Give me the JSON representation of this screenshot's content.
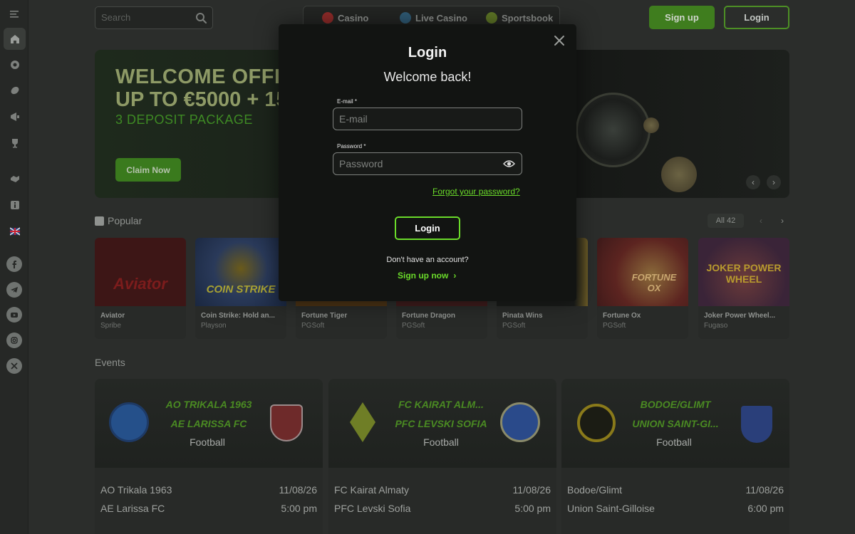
{
  "header": {
    "search_placeholder": "Search",
    "nav": [
      {
        "label": "Casino",
        "icon": "cherry-icon",
        "color": "#b3322f"
      },
      {
        "label": "Live Casino",
        "icon": "globe-icon",
        "color": "#3b6d8c"
      },
      {
        "label": "Sportsbook",
        "icon": "tennis-ball-icon",
        "color": "#6f8a2c"
      }
    ],
    "signup_label": "Sign up",
    "login_label": "Login"
  },
  "sidebar": {
    "items": [
      "menu-icon",
      "home-icon",
      "casino-chip-icon",
      "sports-ball-icon",
      "promotions-icon",
      "trophy-icon",
      "handshake-icon",
      "info-icon",
      "uk-flag-icon"
    ],
    "social": [
      "facebook-icon",
      "telegram-icon",
      "youtube-icon",
      "instagram-icon",
      "x-icon"
    ]
  },
  "hero": {
    "line1": "WELCOME OFFE",
    "line2": "UP TO €5000 + 15",
    "line3": "3 DEPOSIT PACKAGE",
    "cta": "Claim Now",
    "prev": "‹",
    "next": "›"
  },
  "popular": {
    "title": "Popular",
    "all_label": "All",
    "all_count": "42",
    "prev": "‹",
    "next": "›",
    "games": [
      {
        "name": "Aviator",
        "provider": "Spribe",
        "thumb_text": "Aviator",
        "bg": "#4a1818"
      },
      {
        "name": "Coin Strike: Hold an...",
        "provider": "Playson",
        "thumb_text": "COIN STRIKE",
        "bg": "#1c2f52"
      },
      {
        "name": "Fortune Tiger",
        "provider": "PGSoft",
        "thumb_text": "",
        "bg": "#5a3a16"
      },
      {
        "name": "Fortune Dragon",
        "provider": "PGSoft",
        "thumb_text": "",
        "bg": "#4a2020"
      },
      {
        "name": "Pinata Wins",
        "provider": "PGSoft",
        "thumb_text": "",
        "bg": "#5a4a1a"
      },
      {
        "name": "Fortune Ox",
        "provider": "PGSoft",
        "thumb_text": "FORTUNE OX",
        "bg": "#6a2420"
      },
      {
        "name": "Joker Power Wheel...",
        "provider": "Fugaso",
        "thumb_text": "JOKER POWER WHEEL",
        "bg": "#3a2438"
      }
    ]
  },
  "events": {
    "title": "Events",
    "items": [
      {
        "team1_banner": "AO TRIKALA 1963",
        "team2_banner": "AE LARISSA FC",
        "sport": "Football",
        "team1": "AO Trikala 1963",
        "team2": "AE Larissa FC",
        "date": "11/08/26",
        "time": "5:00 pm",
        "logo1_color": "#25508a",
        "logo2_color": "#6e2a2a"
      },
      {
        "team1_banner": "FC KAIRAT ALM...",
        "team2_banner": "PFC LEVSKI SOFIA",
        "sport": "Football",
        "team1": "FC Kairat Almaty",
        "team2": "PFC Levski Sofia",
        "date": "11/08/26",
        "time": "5:00 pm",
        "logo1_color": "#7a8a2a",
        "logo2_color": "#2a4a8a"
      },
      {
        "team1_banner": "BODOE/GLIMT",
        "team2_banner": "UNION SAINT-GI...",
        "sport": "Football",
        "team1": "Bodoe/Glimt",
        "team2": "Union Saint-Gilloise",
        "date": "11/08/26",
        "time": "6:00 pm",
        "logo1_color": "#8a7a1a",
        "logo2_color": "#2a3f7a"
      }
    ]
  },
  "modal": {
    "title": "Login",
    "subtitle": "Welcome back!",
    "email_label": "E-mail *",
    "email_placeholder": "E-mail",
    "password_label": "Password *",
    "password_placeholder": "Password",
    "forgot": "Forgot your password?",
    "login_button": "Login",
    "no_account": "Don't have an account?",
    "signup": "Sign up now",
    "signup_chevron": "›",
    "accent": "#6bdc2a"
  }
}
